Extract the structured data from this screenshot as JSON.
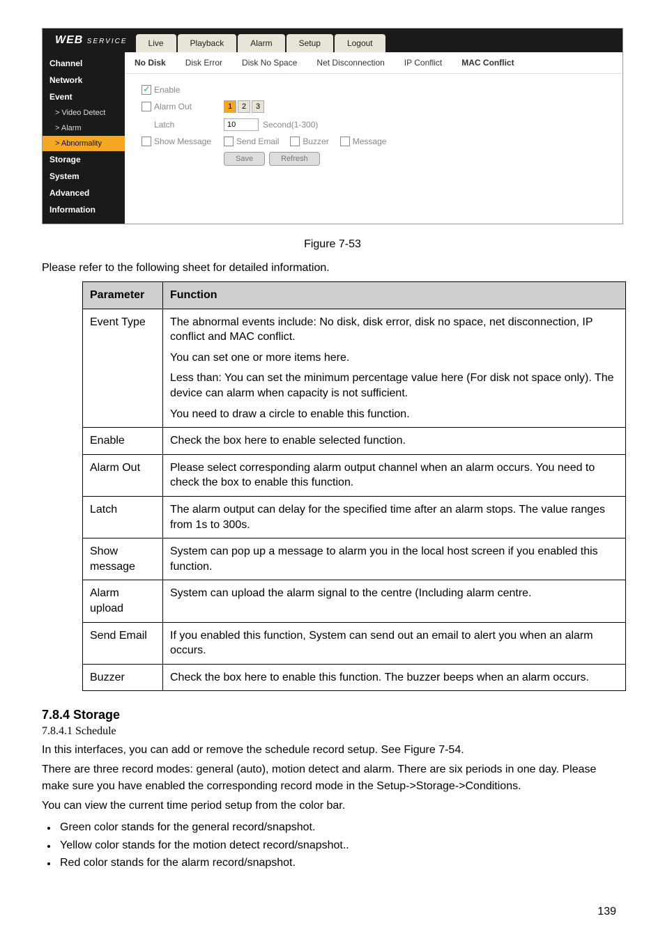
{
  "web_ui": {
    "logo_main": "WEB",
    "logo_sub": "SERVICE",
    "top_tabs": {
      "live": "Live",
      "playback": "Playback",
      "alarm": "Alarm",
      "setup": "Setup",
      "logout": "Logout"
    },
    "sidebar": [
      {
        "label": "Channel",
        "sub": false,
        "active": false
      },
      {
        "label": "Network",
        "sub": false,
        "active": false
      },
      {
        "label": "Event",
        "sub": false,
        "active": false
      },
      {
        "label": "> Video Detect",
        "sub": true,
        "active": false
      },
      {
        "label": "> Alarm",
        "sub": true,
        "active": false
      },
      {
        "label": "> Abnormality",
        "sub": true,
        "active": true
      },
      {
        "label": "Storage",
        "sub": false,
        "active": false
      },
      {
        "label": "System",
        "sub": false,
        "active": false
      },
      {
        "label": "Advanced",
        "sub": false,
        "active": false
      },
      {
        "label": "Information",
        "sub": false,
        "active": false
      }
    ],
    "sub_tabs": {
      "no_disk": "No Disk",
      "disk_error": "Disk Error",
      "disk_no_space": "Disk No Space",
      "net_disc": "Net Disconnection",
      "ip_conflict": "IP Conflict",
      "mac_conflict": "MAC Conflict"
    },
    "form": {
      "enable_label": "Enable",
      "alarm_out_label": "Alarm Out",
      "latch_label": "Latch",
      "latch_value": "10",
      "latch_unit": "Second(1-300)",
      "show_msg_label": "Show Message",
      "send_email_label": "Send Email",
      "buzzer_label": "Buzzer",
      "message_label": "Message",
      "save_btn": "Save",
      "refresh_btn": "Refresh",
      "alarm_out_1": "1",
      "alarm_out_2": "2",
      "alarm_out_3": "3"
    }
  },
  "figure_caption": "Figure 7-53",
  "intro_text": "Please refer to the following sheet for detailed information.",
  "table": {
    "header_param": "Parameter",
    "header_func": "Function",
    "rows": [
      {
        "param": "Event Type",
        "func": [
          "The abnormal events include: No disk, disk error, disk no space, net disconnection, IP conflict and MAC conflict.",
          "You can set one or more items here.",
          "Less than: You can set the minimum percentage value here (For disk not space only). The device can alarm when capacity is not sufficient.",
          "You need to draw a circle to enable this function."
        ]
      },
      {
        "param": "Enable",
        "func": [
          "Check the box here to enable selected function."
        ]
      },
      {
        "param": "Alarm Out",
        "func": [
          "Please select corresponding alarm output channel when an alarm occurs. You need to check the box to enable this function."
        ]
      },
      {
        "param": "Latch",
        "func": [
          "The alarm output can delay for the specified time after an alarm stops. The value ranges from 1s to 300s."
        ]
      },
      {
        "param": "Show message",
        "func": [
          "System can pop up a message to alarm you in the local host screen if you enabled this function."
        ]
      },
      {
        "param": "Alarm upload",
        "func": [
          "System can upload the alarm signal to the centre (Including alarm centre."
        ]
      },
      {
        "param": "Send Email",
        "func": [
          "If you enabled this function, System can send out an email to alert you when an alarm occurs."
        ]
      },
      {
        "param": "Buzzer",
        "func": [
          "Check the box here to enable this function. The buzzer beeps when an alarm occurs."
        ]
      }
    ]
  },
  "section": {
    "heading": "7.8.4  Storage",
    "subheading": "7.8.4.1 Schedule",
    "paras": [
      "In this interfaces, you can add or remove the schedule record setup. See Figure 7-54.",
      "There are three record modes: general (auto), motion detect and alarm. There are six periods in one day. Please make sure you have enabled the corresponding record mode in the Setup->Storage->Conditions.",
      "You can view the current time period setup from the color bar."
    ],
    "bullets": [
      "Green color stands for the general record/snapshot.",
      "Yellow color stands for the motion detect record/snapshot..",
      "Red color stands for the alarm record/snapshot."
    ]
  },
  "page_number": "139"
}
